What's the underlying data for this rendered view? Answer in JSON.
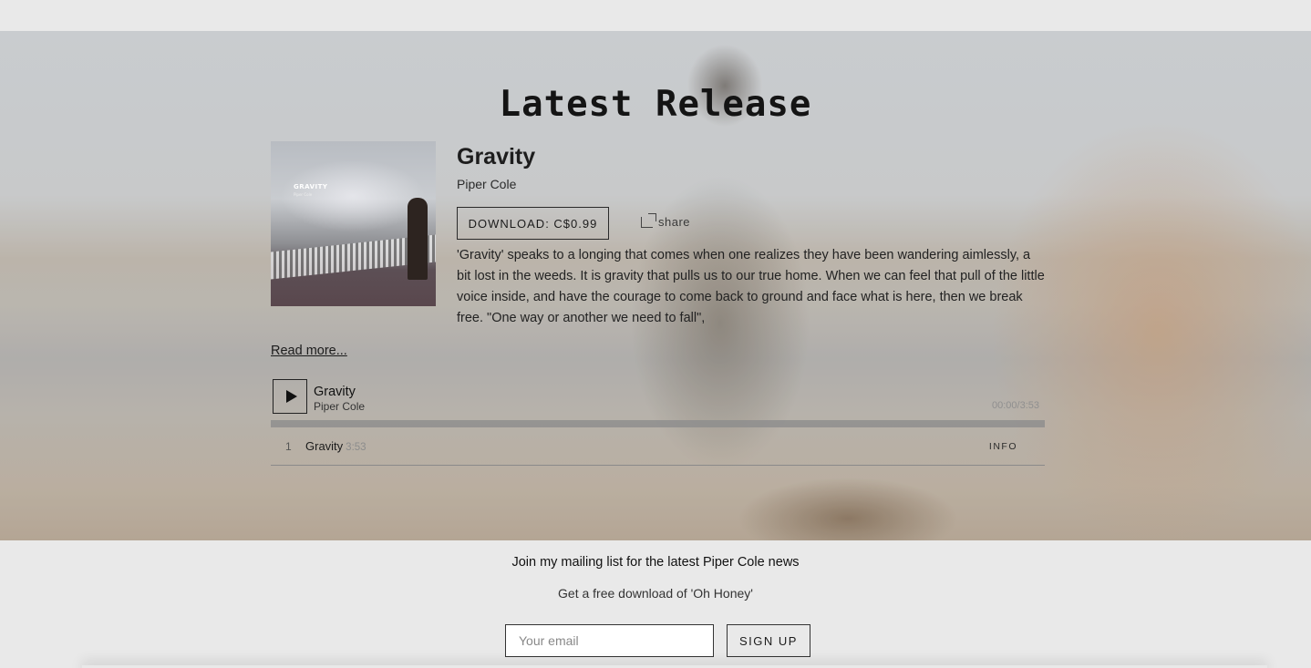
{
  "section": {
    "title": "Latest Release"
  },
  "release": {
    "art_title": "GRAVITY",
    "art_artist": "Piper Cole",
    "title": "Gravity",
    "artist": "Piper Cole",
    "download_label": "DOWNLOAD: C$0.99",
    "share_label": "share",
    "description": "'Gravity' speaks to a longing that comes when one realizes they have been wandering aimlessly, a bit lost in the weeds. It is gravity that pulls us to our true home. When we can feel that pull of the little voice inside, and have the courage to come back to ground and face what is here, then we break free. \"One way or another we need to fall\",",
    "read_more": "Read more..."
  },
  "player": {
    "track": "Gravity",
    "artist": "Piper Cole",
    "time": "00:00/3:53",
    "progress": 0
  },
  "tracklist": [
    {
      "num": "1",
      "title": "Gravity",
      "duration": "3:53",
      "info": "INFO"
    }
  ],
  "mailing": {
    "title": "Join my mailing list for the latest Piper Cole news",
    "subtitle": "Get a free download of 'Oh Honey'",
    "email_placeholder": "Your email",
    "signup_label": "SIGN UP"
  },
  "icons": {
    "play": "play-icon",
    "share": "share-icon"
  }
}
